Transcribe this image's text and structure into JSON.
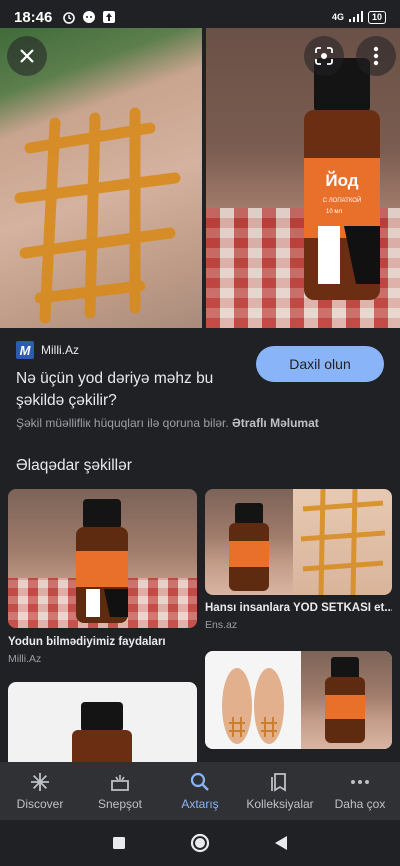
{
  "status_bar": {
    "time": "18:46",
    "network": "4G",
    "battery": "10"
  },
  "hero": {
    "close_icon": "close-icon",
    "lens_icon": "lens-icon",
    "more_icon": "more-vert-icon",
    "bottle_label_title": "Йод",
    "bottle_label_sub": "С ЛОПАТКОЙ",
    "bottle_label_vol": "10 мл"
  },
  "source": {
    "logo_letter": "M",
    "name": "Milli.Az"
  },
  "headline": "Nə üçün yod dəriyə məhz bu şəkildə çəkilir?",
  "visit_button": "Daxil olun",
  "copyright": {
    "text": "Şəkil müəllifliк hüquqları ilə qoruna bilər.",
    "link": "Ətraflı Məlumat"
  },
  "related_title": "Əlaqədar şəkillər",
  "related": [
    {
      "caption": "Yodun bilmədiyimiz faydaları",
      "source": "Milli.Az"
    },
    {
      "caption": "Hansı insanlara YOD SETKASI et...",
      "source": "Ens.az"
    },
    {
      "caption": "",
      "source": ""
    },
    {
      "caption": "",
      "source": ""
    }
  ],
  "bottom_nav": [
    {
      "label": "Discover",
      "icon": "asterisk-icon"
    },
    {
      "label": "Snepşot",
      "icon": "snapshot-icon"
    },
    {
      "label": "Axtarış",
      "icon": "search-icon"
    },
    {
      "label": "Kolleksiyalar",
      "icon": "collections-icon"
    },
    {
      "label": "Daha çox",
      "icon": "more-horiz-icon"
    }
  ],
  "colors": {
    "accent": "#8ab4f8",
    "background": "#202124",
    "nav_bg": "#303134"
  }
}
